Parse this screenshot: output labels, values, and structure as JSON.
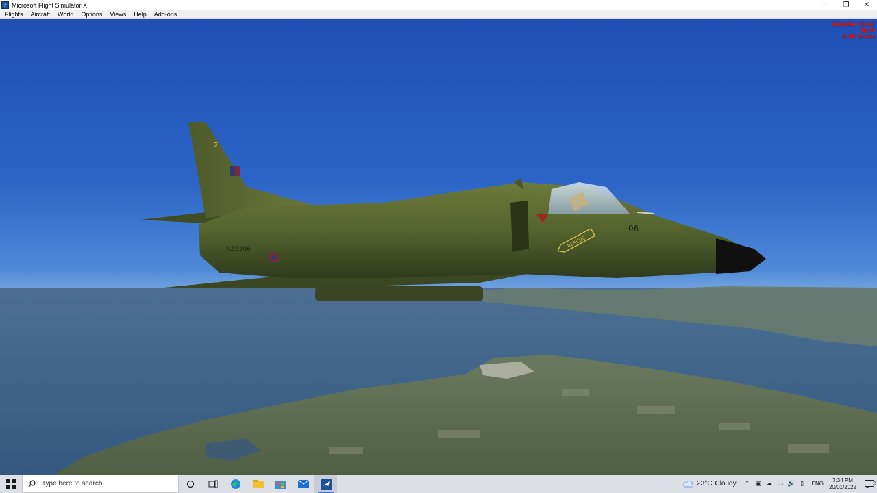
{
  "window": {
    "title": "Microsoft Flight Simulator X",
    "minimize": "—",
    "maximize": "❐",
    "close": "✕"
  },
  "menu": [
    "Flights",
    "Aircraft",
    "World",
    "Options",
    "Views",
    "Help",
    "Add-ons"
  ],
  "overlay": {
    "line1": "Outside View:",
    "line2": "Spot",
    "line3": "0.60 Zoom"
  },
  "aircraft": {
    "serial": "NZ6206",
    "number": "06",
    "rescue": "RESCUE",
    "fin": "2"
  },
  "taskbar": {
    "search_placeholder": "Type here to search",
    "weather_temp": "23°C",
    "weather_desc": "Cloudy",
    "lang": "ENG",
    "time": "7:34 PM",
    "date": "20/01/2022",
    "notif_count": "2",
    "icons": [
      "start-icon",
      "cortana-icon",
      "task-view-icon",
      "edge-icon",
      "file-explorer-icon",
      "store-icon",
      "mail-icon",
      "fsx-icon"
    ]
  }
}
